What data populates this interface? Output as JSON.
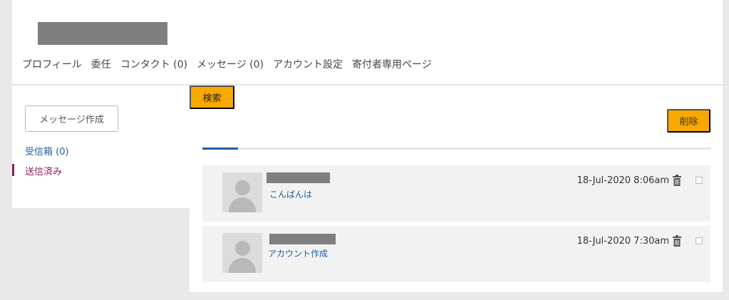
{
  "profile_nav": {
    "items": [
      "プロフィール",
      "委任",
      "コンタクト (0)",
      "メッセージ (0)",
      "アカウント設定",
      "寄付者専用ページ"
    ]
  },
  "sidebar": {
    "compose_label": "メッセージ作成",
    "inbox_label": "受信箱 (0)",
    "sent_label": "送信済み"
  },
  "toolbar": {
    "search_label": "検索",
    "delete_label": "削除"
  },
  "messages": [
    {
      "subject": "こんばんは",
      "date": "18-Jul-2020 8:06am"
    },
    {
      "subject": "アカウント作成",
      "date": "18-Jul-2020 7:30am"
    }
  ],
  "colors": {
    "accent": "#8b1f5c",
    "link": "#1f5f9e",
    "button": "#f8a900"
  },
  "icons": [
    "trash-icon",
    "avatar-placeholder-icon",
    "checkbox"
  ]
}
